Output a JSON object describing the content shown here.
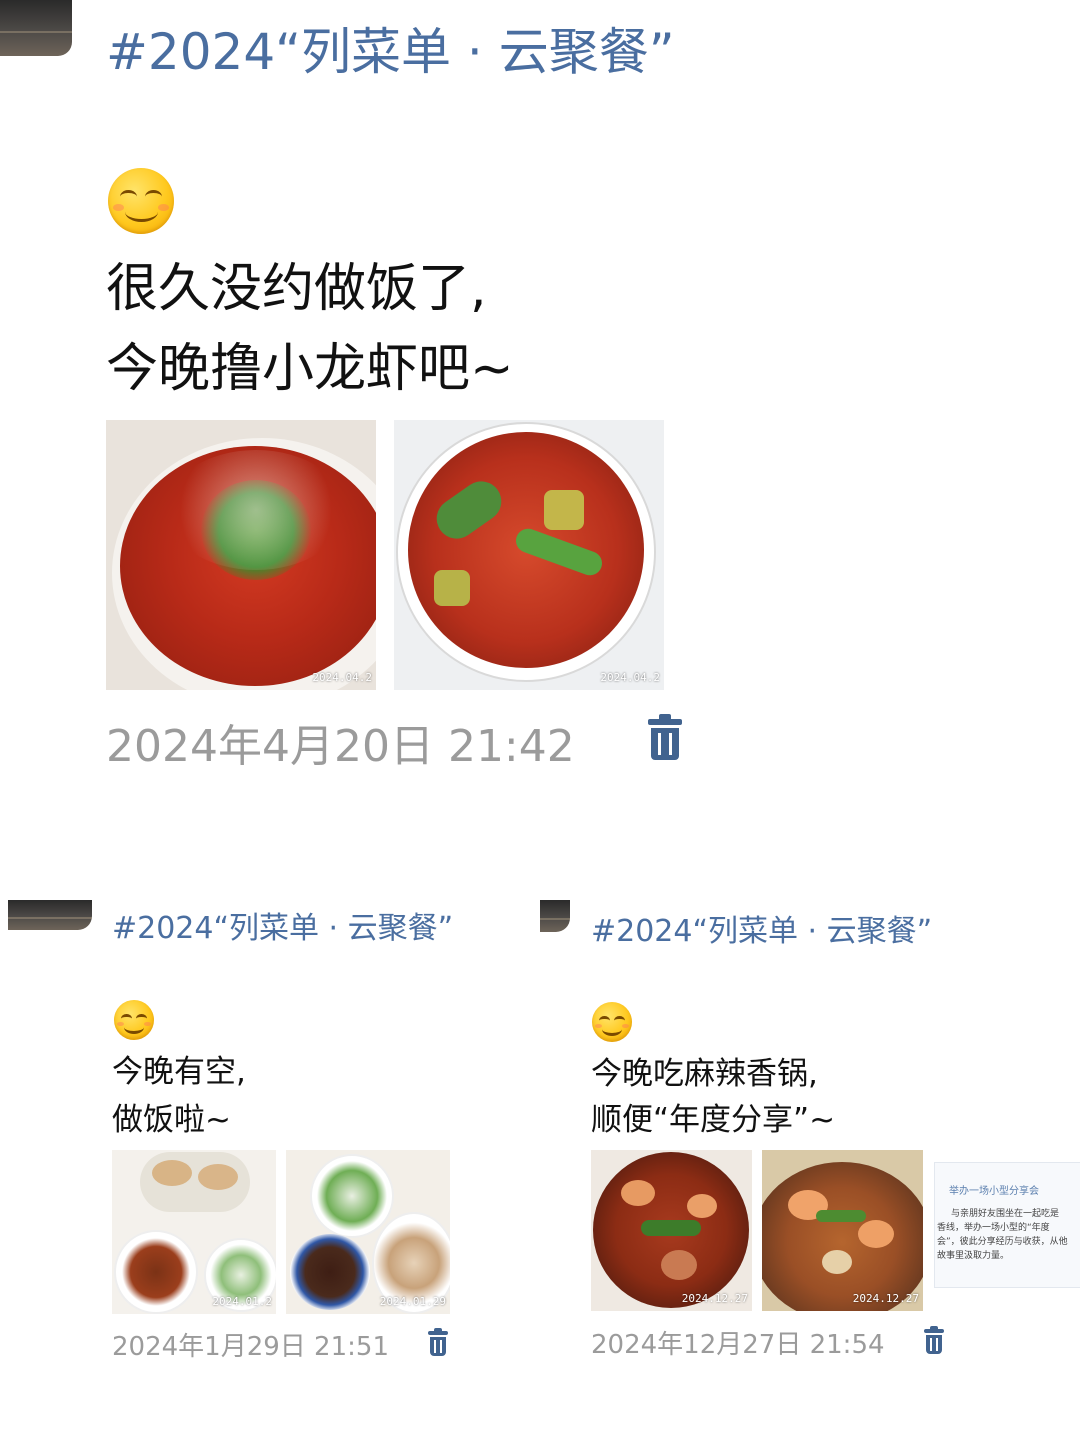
{
  "posts": [
    {
      "topic": "#2024“列菜单 · 云聚餐”",
      "emoji": "smiling-face-emoji",
      "text_line1": "很久没约做饭了,",
      "text_line2": "今晚撸小龙虾吧~",
      "photos": [
        {
          "name": "crayfish-platter-photo",
          "stamp": "2024.04.2"
        },
        {
          "name": "crayfish-bowl-photo",
          "stamp": "2024.04.2"
        }
      ],
      "date": "2024年4月20日 21:42",
      "delete_icon": "trash-icon"
    },
    {
      "topic": "#2024“列菜单 · 云聚餐”",
      "emoji": "smiling-face-emoji",
      "text_line1": "今晚有空,",
      "text_line2": "做饭啦~",
      "photos": [
        {
          "name": "mussels-dishes-photo",
          "stamp": "2024.01.2"
        },
        {
          "name": "seafood-dishes-photo",
          "stamp": "2024.01.29"
        }
      ],
      "date": "2024年1月29日 21:51",
      "delete_icon": "trash-icon"
    },
    {
      "topic": "#2024“列菜单 · 云聚餐”",
      "emoji": "smiling-face-emoji",
      "text_line1": "今晚吃麻辣香锅,",
      "text_line2": "顺便“年度分享”~",
      "photos": [
        {
          "name": "spicy-pot-photo-1",
          "stamp": "2024.12.27"
        },
        {
          "name": "spicy-pot-photo-2",
          "stamp": "2024.12.27"
        }
      ],
      "doc_preview": {
        "title": "举办一场小型分享会",
        "line1": "与亲朋好友围坐在一起吃是",
        "line2": "香线，举办一场小型的“年度",
        "line3": "会”，彼此分享经历与收获，从他",
        "line4": "故事里汲取力量。"
      },
      "date": "2024年12月27日 21:54",
      "delete_icon": "trash-icon"
    }
  ],
  "colors": {
    "topic": "#4a6ea0",
    "date": "#9b9b9b",
    "trash": "#41638f",
    "crayfish": "#c8321e"
  }
}
